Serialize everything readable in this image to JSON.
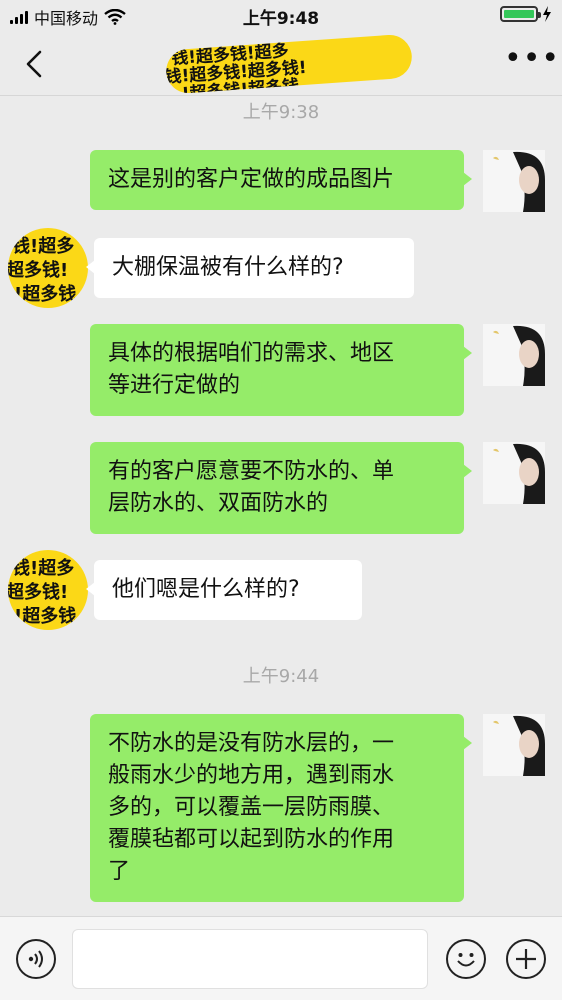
{
  "status": {
    "carrier": "中国移动",
    "time": "上午9:48"
  },
  "nav": {
    "title_tiles": [
      "钱!超多钱!超多",
      "钱!超多钱!超多钱!",
      "!超多钱!超多钱"
    ]
  },
  "avatar_other_tiles": [
    "钱!超多",
    "超多钱!",
    "!超多钱"
  ],
  "messages": [
    {
      "kind": "time",
      "text": "上午9:38"
    },
    {
      "kind": "me",
      "lines": [
        "这是别的客户定做的成品图片"
      ]
    },
    {
      "kind": "other",
      "lines": [
        "大棚保温被有什么样的?"
      ]
    },
    {
      "kind": "me",
      "lines": [
        "具体的根据咱们的需求、地区",
        "等进行定做的"
      ]
    },
    {
      "kind": "me",
      "lines": [
        "有的客户愿意要不防水的、单",
        "层防水的、双面防水的"
      ]
    },
    {
      "kind": "other",
      "lines": [
        "他们嗯是什么样的?"
      ]
    },
    {
      "kind": "time",
      "text": "上午9:44"
    },
    {
      "kind": "me",
      "lines": [
        "不防水的是没有防水层的，一",
        "般雨水少的地方用，遇到雨水",
        "多的，可以覆盖一层防雨膜、",
        "覆膜毡都可以起到防水的作用",
        "了"
      ]
    }
  ],
  "input": {
    "value": "",
    "placeholder": ""
  },
  "colors": {
    "me_bubble": "#95ec69",
    "other_bubble": "#ffffff",
    "background": "#ebebeb",
    "avatar_yellow": "#fbd817"
  }
}
